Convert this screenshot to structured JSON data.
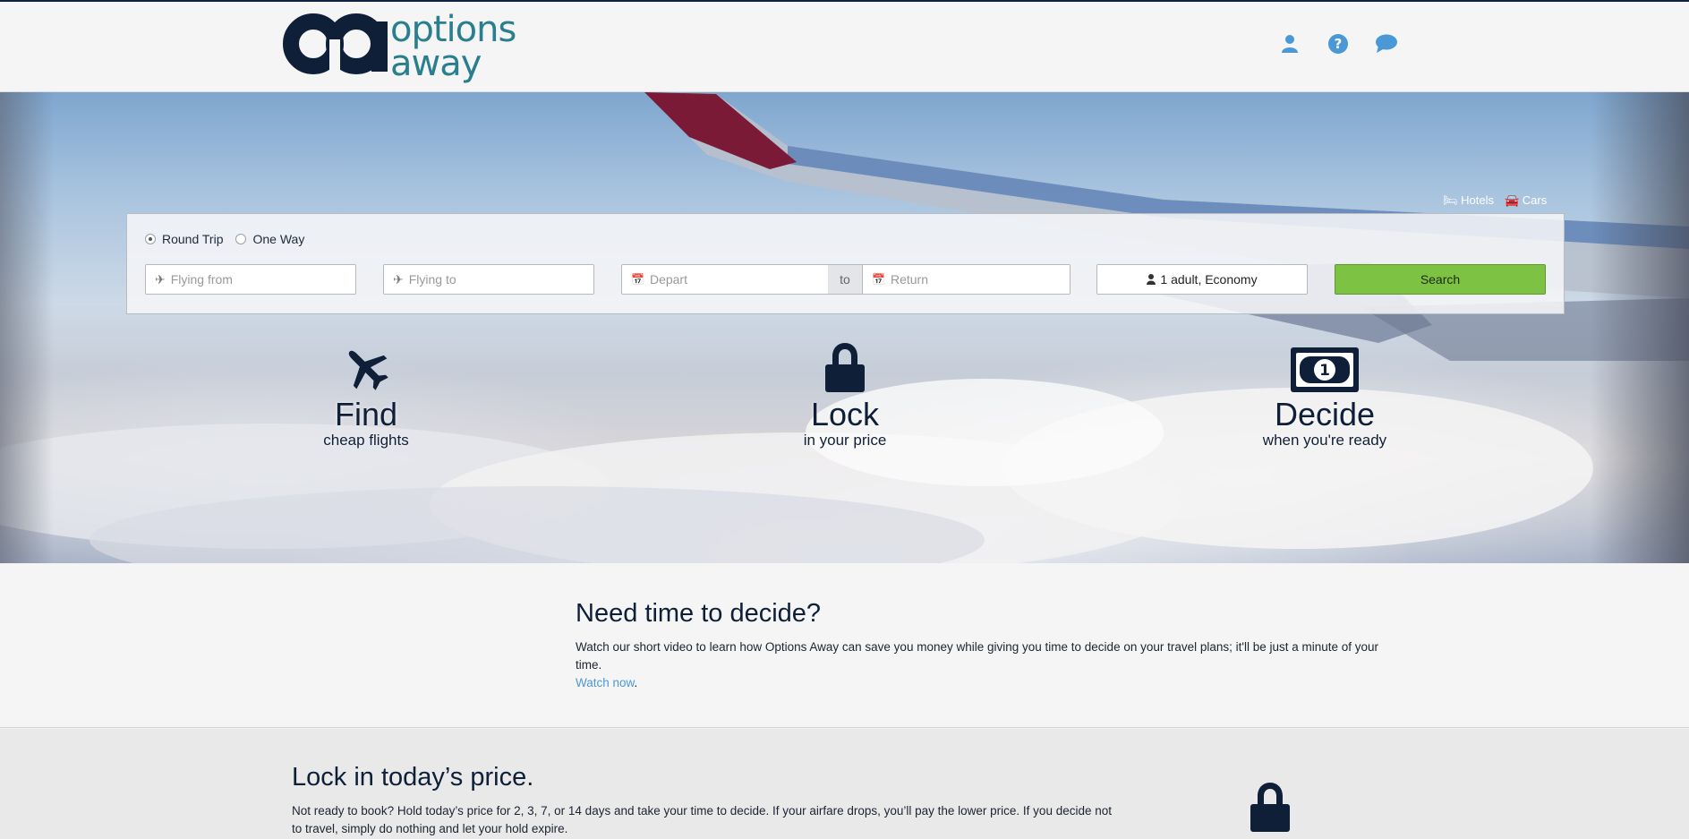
{
  "header": {
    "logo_line1": "options",
    "logo_line2": "away",
    "icons": [
      "user-icon",
      "help-icon",
      "chat-icon"
    ]
  },
  "hero": {
    "links": {
      "hotels": "Hotels",
      "cars": "Cars"
    },
    "search": {
      "trip_types": [
        "Round Trip",
        "One Way"
      ],
      "selected_trip": "Round Trip",
      "from_placeholder": "Flying from",
      "to_placeholder": "Flying to",
      "depart_placeholder": "Depart",
      "to_sep": "to",
      "return_placeholder": "Return",
      "passengers": "1 adult, Economy",
      "search_label": "Search"
    },
    "features": [
      {
        "title": "Find",
        "subtitle": "cheap flights",
        "icon": "plane-icon"
      },
      {
        "title": "Lock",
        "subtitle": "in your price",
        "icon": "lock-icon"
      },
      {
        "title": "Decide",
        "subtitle": "when you're ready",
        "icon": "dollar-bill-icon"
      }
    ]
  },
  "decide_section": {
    "heading": "Need time to decide?",
    "body": "Watch our short video to learn how Options Away can save you money while giving you time to decide on your travel plans; it'll be just a minute of your time.",
    "link": "Watch now",
    "link_suffix": "."
  },
  "lock_section": {
    "heading": "Lock in today’s price.",
    "body": "Not ready to book? Hold today’s price for 2, 3, 7, or 14 days and take your time to decide. If your airfare drops, you’ll pay the lower price. If you decide not to travel, simply do nothing and let your hold expire."
  },
  "colors": {
    "brand_navy": "#0f1f38",
    "brand_teal": "#2a7f8e",
    "link_blue": "#4a98d6",
    "search_green": "#7dc243",
    "wing_red": "#7a1a36"
  }
}
